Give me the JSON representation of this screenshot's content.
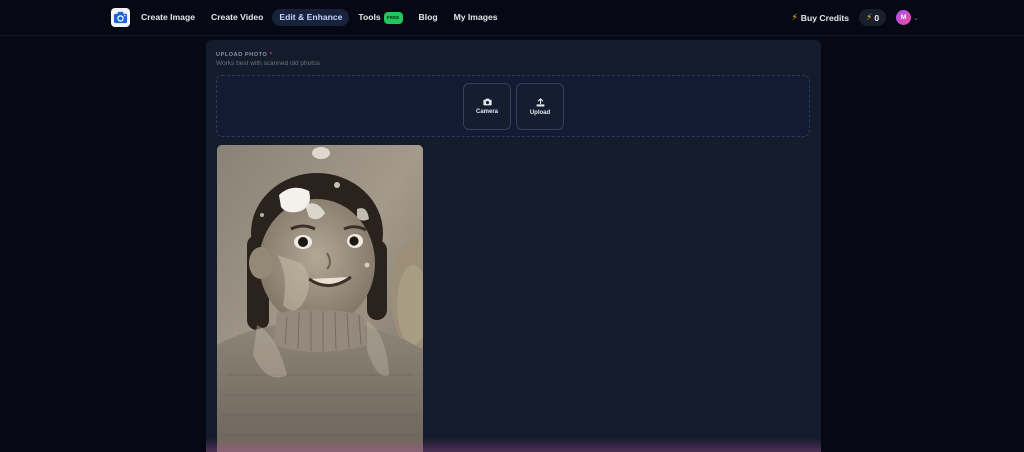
{
  "nav": {
    "items": [
      {
        "label": "Create Image",
        "active": false
      },
      {
        "label": "Create Video",
        "active": false
      },
      {
        "label": "Edit & Enhance",
        "active": true
      },
      {
        "label": "Tools",
        "active": false,
        "badge": "FREE"
      },
      {
        "label": "Blog",
        "active": false
      },
      {
        "label": "My Images",
        "active": false
      }
    ],
    "buy_credits": "Buy Credits",
    "credits": "0",
    "avatar_initial": "M"
  },
  "upload": {
    "label": "UPLOAD PHOTO",
    "required_mark": "*",
    "hint": "Works best with scanned old photos",
    "camera_label": "Camera",
    "upload_label": "Upload"
  },
  "colors": {
    "background": "#060913",
    "panel": "#141b2a",
    "active_nav": "#17223b",
    "free_badge": "#22c55e",
    "bolt": "#facc15"
  },
  "icons": {
    "logo": "camera-logo-icon",
    "bolt": "lightning-bolt-icon",
    "camera": "camera-icon",
    "upload": "upload-tray-icon",
    "chevron": "chevron-down-icon"
  }
}
